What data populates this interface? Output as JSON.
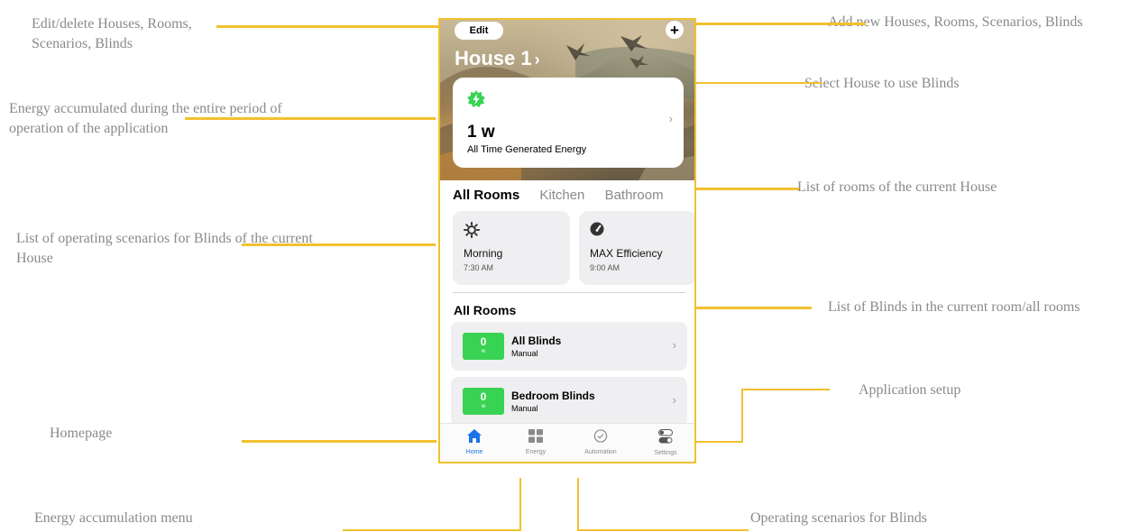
{
  "annotations": {
    "edit": "Edit/delete Houses, Rooms, Scenarios, Blinds",
    "add": "Add new Houses, Rooms, Scenarios, Blinds",
    "select_house": "Select House to use Blinds",
    "energy": "Energy accumulated during the entire period of operation of the application",
    "rooms_list": "List of rooms of the current House",
    "scenarios": "List of operating scenarios for Blinds of the current House",
    "blinds_list": "List of Blinds in the current room/all rooms",
    "setup": "Application setup",
    "homepage": "Homepage",
    "energy_menu": "Energy accumulation menu",
    "operating_scenarios": "Operating scenarios for Blinds"
  },
  "app": {
    "edit_label": "Edit",
    "add_label": "+",
    "house_title": "House 1",
    "house_chevron": "›",
    "energy": {
      "value": "1 w",
      "label": "All Time Generated Energy",
      "chevron": "›"
    },
    "rooms_tabs": [
      "All Rooms",
      "Kitchen",
      "Bathroom"
    ],
    "scenarios": [
      {
        "name": "Morning",
        "time": "7:30 AM",
        "icon": "sun-icon"
      },
      {
        "name": "MAX Efficiency",
        "time": "9:00 AM",
        "icon": "speedometer-icon"
      }
    ],
    "section_title": "All Rooms",
    "blinds": [
      {
        "value": "0",
        "unit": "w",
        "name": "All Blinds",
        "mode": "Manual"
      },
      {
        "value": "0",
        "unit": "w",
        "name": "Bedroom Blinds",
        "mode": "Manual"
      }
    ],
    "nav": [
      "Home",
      "Energy",
      "Automation",
      "Settings"
    ]
  },
  "colors": {
    "accent_line": "#f2c12e",
    "badge_green": "#39d353",
    "nav_active": "#1a73e8"
  }
}
